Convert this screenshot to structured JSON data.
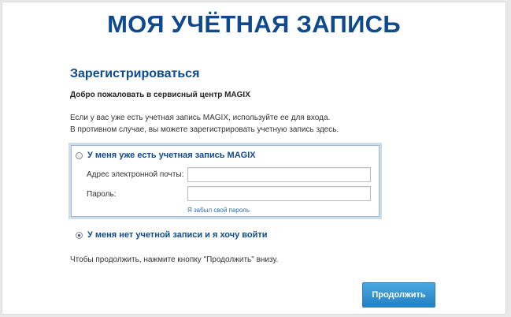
{
  "header": {
    "title": "МОЯ УЧЁТНАЯ ЗАПИСЬ"
  },
  "register": {
    "title": "Зарегистрироваться",
    "welcome": "Добро пожаловать в сервисный центр MAGIX",
    "intro_line1": "Если у вас уже есть учетная запись MAGIX, используйте ее для входа.",
    "intro_line2": "В противном случае, вы можете зарегистрировать учетную запись здесь."
  },
  "login_option": {
    "label": "У меня уже есть учетная запись MAGIX",
    "selected": false,
    "email_label": "Адрес электронной почты:",
    "email_value": "",
    "password_label": "Пароль:",
    "password_value": "",
    "forgot_link": "Я забыл свой пароль"
  },
  "no_account_option": {
    "label": "У меня нет учетной записи и я хочу войти",
    "selected": true
  },
  "footer": {
    "hint": "Чтобы продолжить, нажмите кнопку \"Продолжить\" внизу.",
    "continue_label": "Продолжить"
  },
  "colors": {
    "heading": "#0e4a8c",
    "button": "#2f8fd0",
    "link": "#2a6fb0"
  }
}
